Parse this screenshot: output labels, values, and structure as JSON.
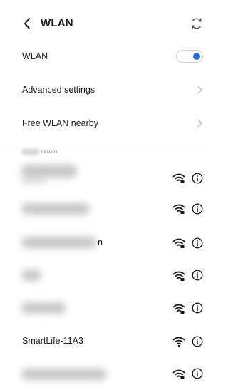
{
  "header": {
    "title": "WLAN",
    "back_icon": "chevron-left-icon",
    "refresh_icon": "refresh-icon"
  },
  "settings": {
    "wlan_label": "WLAN",
    "wlan_enabled": true,
    "advanced_label": "Advanced settings",
    "free_label": "Free WLAN nearby"
  },
  "section": {
    "label": "network"
  },
  "networks": [
    {
      "name": "",
      "secured": true
    },
    {
      "name": "",
      "secured": true
    },
    {
      "name": "n",
      "secured": true
    },
    {
      "name": "",
      "secured": true
    },
    {
      "name": "",
      "secured": true
    },
    {
      "name": "SmartLife-11A3",
      "secured": false
    },
    {
      "name": "",
      "secured": true
    }
  ],
  "colors": {
    "accent": "#2e6bd8",
    "text": "#1a1a1a",
    "chevron": "#b5b5b5"
  }
}
